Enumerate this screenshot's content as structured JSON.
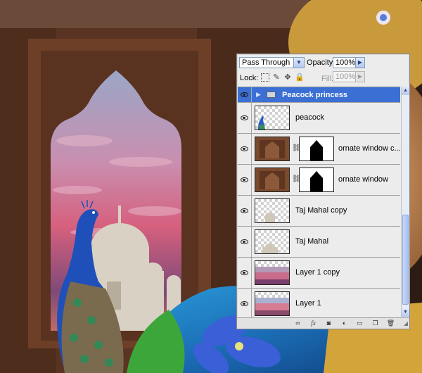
{
  "layers_panel": {
    "blend_mode": "Pass Through",
    "opacity_label": "Opacity:",
    "opacity_value": "100%",
    "lock_label": "Lock:",
    "fill_label": "Fill:",
    "fill_value": "100%",
    "lock_icons": [
      "lock-transparent-icon",
      "lock-paint-icon",
      "lock-move-icon",
      "lock-all-icon"
    ],
    "layers": [
      {
        "name": "Peacock princess",
        "type": "group",
        "visible": true,
        "selected": true
      },
      {
        "name": "peacock",
        "type": "layer",
        "visible": true
      },
      {
        "name": "ornate window c...",
        "type": "layer-with-mask",
        "visible": true
      },
      {
        "name": "ornate window",
        "type": "layer-with-mask",
        "visible": true
      },
      {
        "name": "Taj Mahal copy",
        "type": "layer",
        "visible": true
      },
      {
        "name": "Taj Mahal",
        "type": "layer",
        "visible": true
      },
      {
        "name": "Layer 1 copy",
        "type": "layer",
        "visible": true
      },
      {
        "name": "Layer 1",
        "type": "layer",
        "visible": true
      }
    ],
    "bottom_icons": [
      "link-layers-icon",
      "layer-style-icon",
      "add-mask-icon",
      "adjustment-layer-icon",
      "new-group-icon",
      "new-layer-icon",
      "delete-layer-icon"
    ]
  },
  "colors": {
    "selection_blue": "#3b6fd4",
    "panel_bg": "#ececec"
  }
}
